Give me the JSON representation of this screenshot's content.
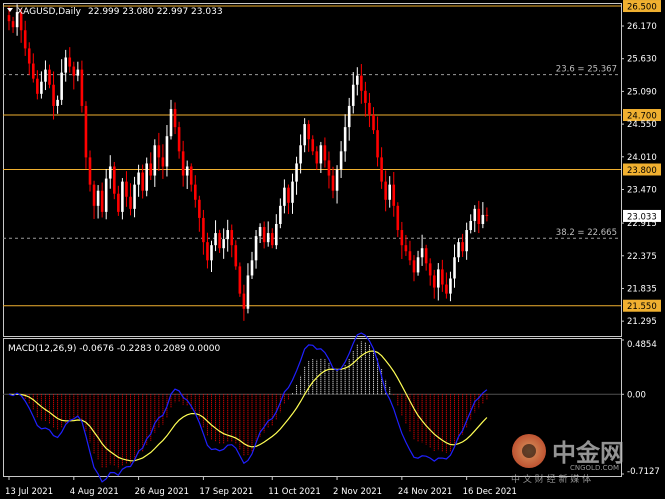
{
  "chart_data": [
    {
      "type": "candlestick",
      "panel": "price",
      "symbol_label": "XAGUSD,Daily",
      "ohlc_label": "22.999 23.080 22.997 23.033",
      "ylim": [
        21.05,
        26.55
      ],
      "y_ticks": [
        "26.170",
        "25.630",
        "25.090",
        "24.550",
        "24.010",
        "23.470",
        "22.915",
        "22.375",
        "21.835",
        "21.295"
      ],
      "x_ticks": [
        "13 Jul 2021",
        "4 Aug 2021",
        "26 Aug 2021",
        "17 Sep 2021",
        "11 Oct 2021",
        "2 Nov 2021",
        "24 Nov 2021",
        "16 Dec 2021"
      ],
      "last_price_label": "23.033",
      "last_price": 23.033,
      "horizontal_levels": [
        {
          "value": 26.5,
          "label": "26.500",
          "color": "#f0b030"
        },
        {
          "value": 24.7,
          "label": "24.700",
          "color": "#f0b030"
        },
        {
          "value": 23.8,
          "label": "23.800",
          "color": "#f0b030"
        },
        {
          "value": 21.55,
          "label": "21.550",
          "color": "#f0b030"
        }
      ],
      "fib_levels": [
        {
          "value": 25.367,
          "label": "23.6 = 25.367"
        },
        {
          "value": 22.665,
          "label": "38.2 = 22.665"
        }
      ],
      "close": [
        26.25,
        26.15,
        26.4,
        26.1,
        25.8,
        25.55,
        25.3,
        25.05,
        25.25,
        25.45,
        25.2,
        24.85,
        24.95,
        25.4,
        25.65,
        25.5,
        25.35,
        25.45,
        24.85,
        24.0,
        23.55,
        23.2,
        23.45,
        23.1,
        23.65,
        23.85,
        23.4,
        23.1,
        23.6,
        23.35,
        23.15,
        23.55,
        23.75,
        23.45,
        23.9,
        23.7,
        24.2,
        24.0,
        23.85,
        24.35,
        24.8,
        24.5,
        24.1,
        23.7,
        23.85,
        23.55,
        23.3,
        23.0,
        22.6,
        22.3,
        22.55,
        22.75,
        22.5,
        22.65,
        22.8,
        22.55,
        22.2,
        21.75,
        21.5,
        22.05,
        22.3,
        22.7,
        22.85,
        22.6,
        22.75,
        22.55,
        22.9,
        23.2,
        23.5,
        23.25,
        23.6,
        23.9,
        24.2,
        24.55,
        24.3,
        24.1,
        23.9,
        24.2,
        23.95,
        23.7,
        23.45,
        23.8,
        24.1,
        24.5,
        24.85,
        25.2,
        25.35,
        25.1,
        24.9,
        24.7,
        24.45,
        24.0,
        23.6,
        23.3,
        23.55,
        23.2,
        22.8,
        22.55,
        22.45,
        22.3,
        22.1,
        22.35,
        22.5,
        22.25,
        22.05,
        21.85,
        22.15,
        21.9,
        21.75,
        22.0,
        22.35,
        22.6,
        22.45,
        22.8,
        22.95,
        23.15,
        22.9,
        23.05,
        23.033
      ],
      "series_colors": {
        "up": "#ffffff",
        "down": "#ff0000"
      }
    },
    {
      "type": "macd",
      "panel": "indicator",
      "label": "MACD(12,26,9) -0.0676 -0.2283 0.2089 0.0000",
      "ylim": [
        -0.7127,
        0.4854
      ],
      "y_ticks": [
        "0.4854",
        "0.00",
        "-0.7127"
      ],
      "colors": {
        "histogram_up": "#ffffff",
        "histogram_down": "#ff0000",
        "signal": "#ffff55",
        "macd": "#2020ff"
      }
    }
  ],
  "watermark": {
    "name": "中金网",
    "url": "CNGOLD.COM",
    "slogan": "中 文 财 经 新 媒 体"
  }
}
